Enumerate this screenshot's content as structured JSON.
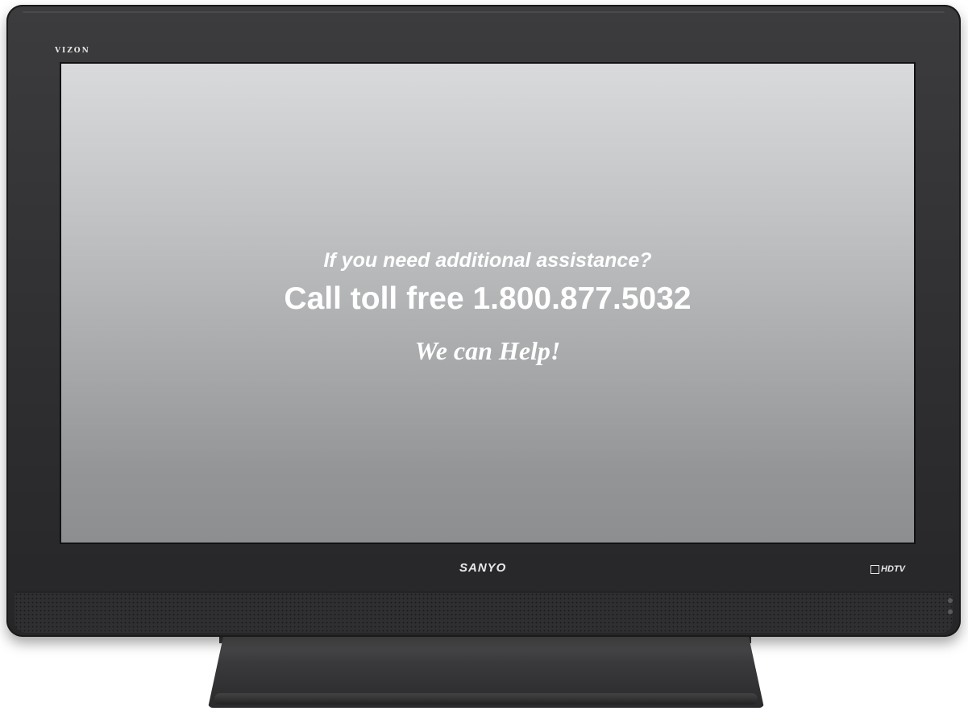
{
  "tv": {
    "brand_top": "VIZON",
    "brand_bottom": "SANYO",
    "badge": "HDTV"
  },
  "screen": {
    "line1": "If you need additional assistance?",
    "line2": "Call toll free 1.800.877.5032",
    "line3": "We can Help!"
  },
  "colors": {
    "bezel": "#2e2e30",
    "screen_top": "#d9dadc",
    "screen_bottom": "#8c8e90",
    "text": "#ffffff"
  }
}
